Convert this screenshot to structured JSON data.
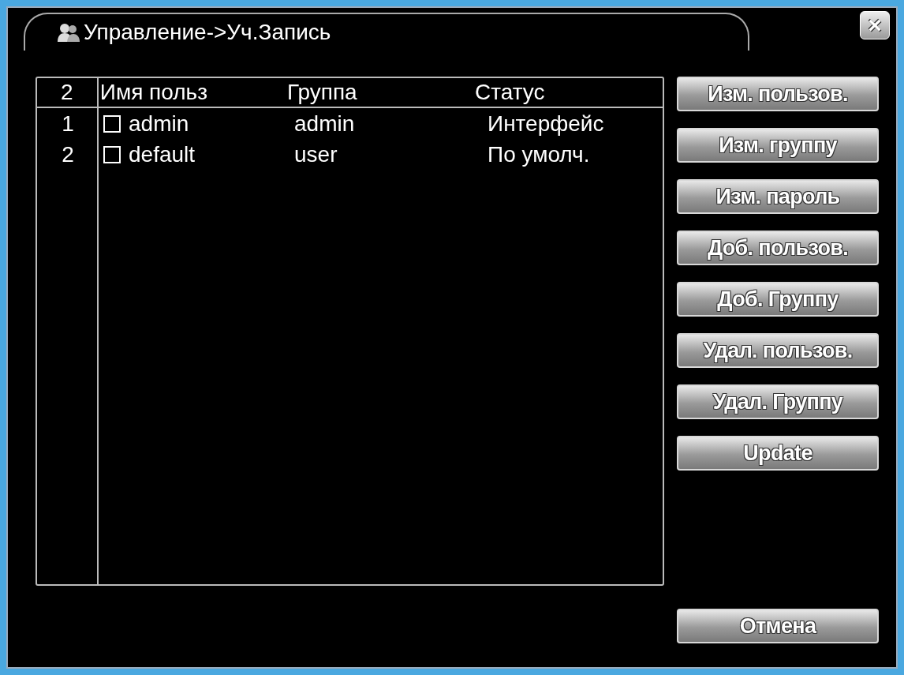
{
  "window": {
    "title": "Управление->Уч.Запись",
    "close": "×"
  },
  "table": {
    "columns": [
      "2",
      "Имя польз",
      "Группа",
      "Статус"
    ],
    "rows": [
      {
        "index": "1",
        "checked": false,
        "name": "admin",
        "group": "admin",
        "status": "Интерфейс"
      },
      {
        "index": "2",
        "checked": false,
        "name": "default",
        "group": "user",
        "status": "По умолч."
      }
    ]
  },
  "buttons": [
    "Изм. пользов.",
    "Изм. группу",
    "Изм. пароль",
    "Доб. пользов.",
    "Доб. Группу",
    "Удал. пользов.",
    "Удал. Группу",
    "Update"
  ],
  "cancel": "Отмена"
}
